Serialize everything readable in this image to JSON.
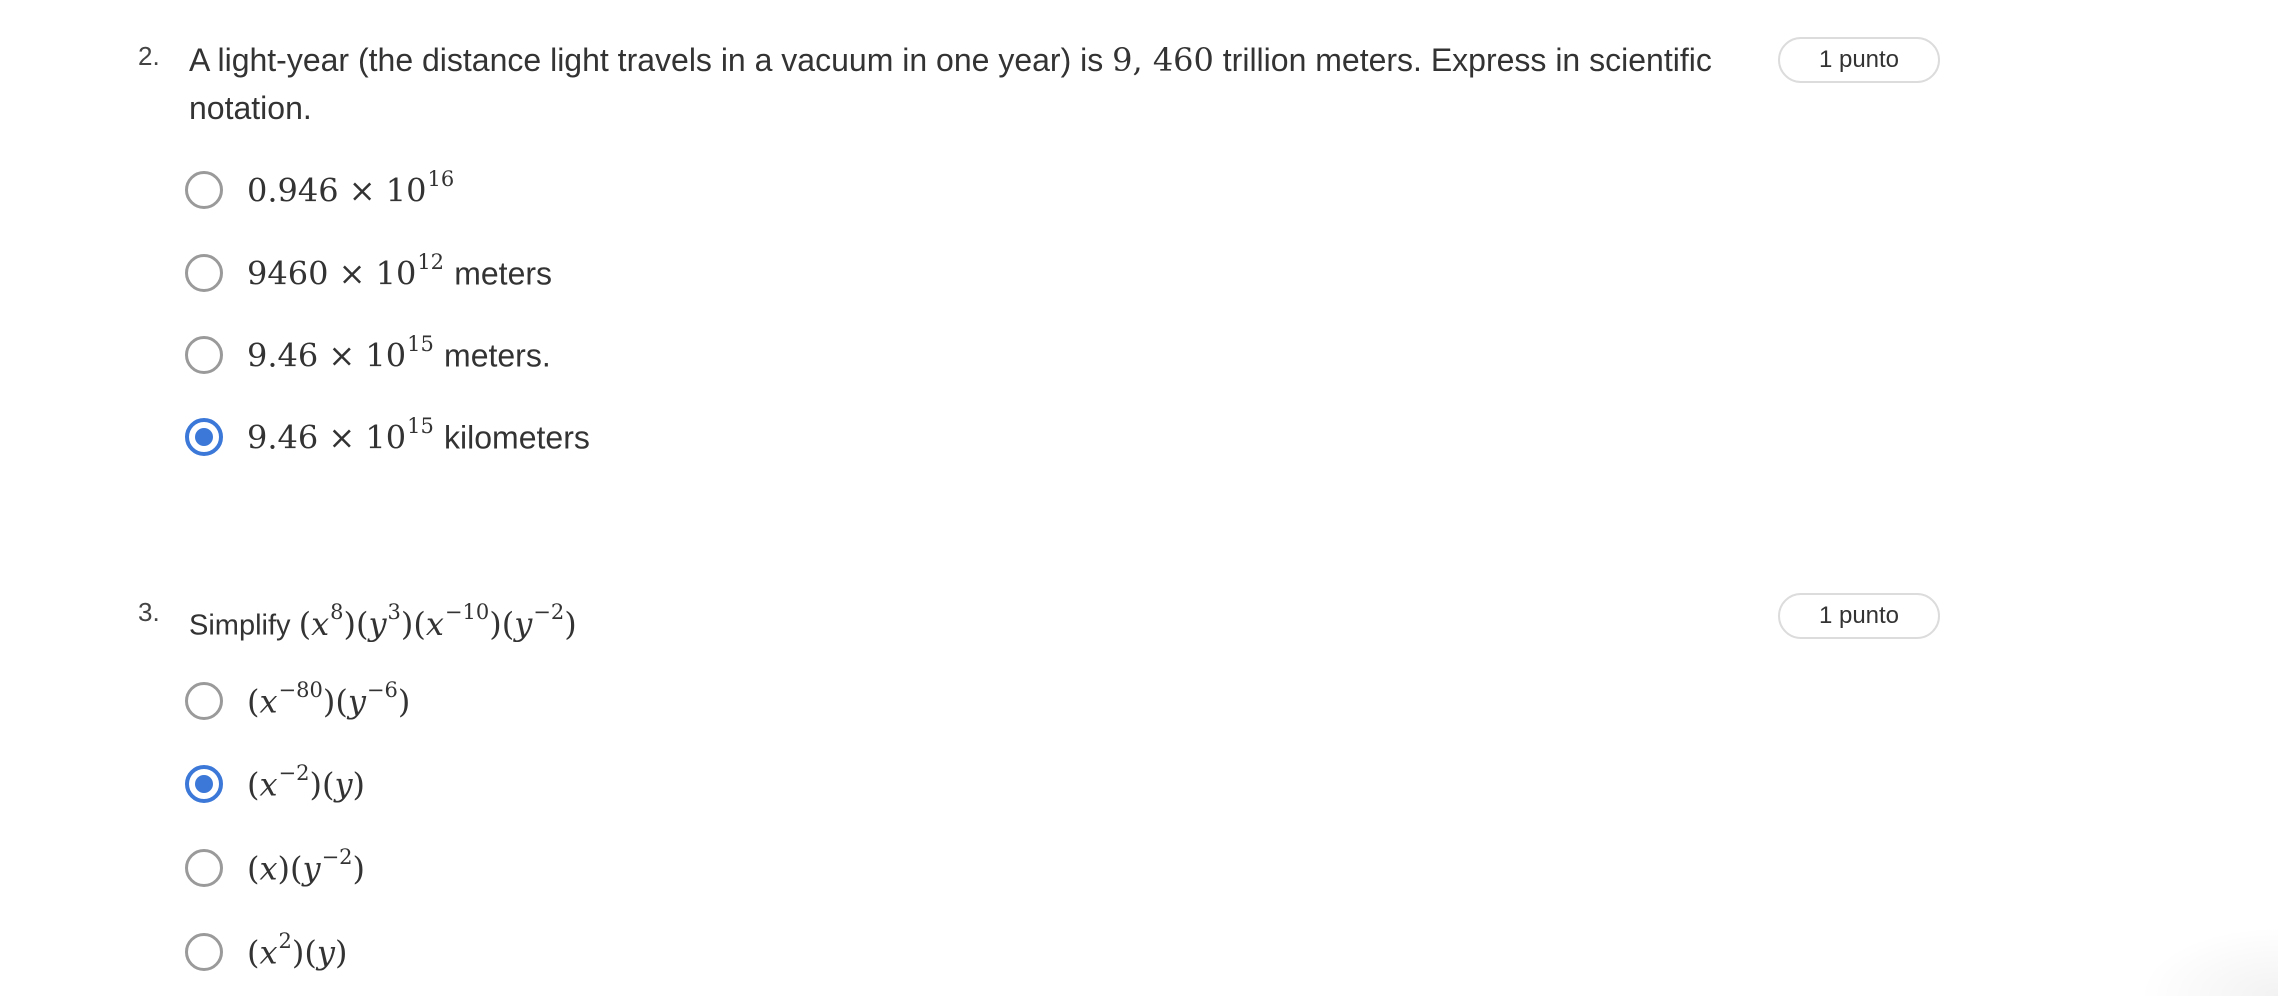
{
  "questions": [
    {
      "number": "2.",
      "text_before": "A light-year (the distance light travels in a vacuum in one year) is",
      "text_math": "9, 460",
      "text_after": "trillion meters. Express in scientific notation.",
      "points": "1 punto",
      "options": [
        {
          "coef": "0.946",
          "times": "×",
          "base": "10",
          "exp": "16",
          "unit": "",
          "selected": false
        },
        {
          "coef": "9460",
          "times": "×",
          "base": "10",
          "exp": "12",
          "unit": "meters",
          "selected": false
        },
        {
          "coef": "9.46",
          "times": "×",
          "base": "10",
          "exp": "15",
          "unit": "meters.",
          "selected": false
        },
        {
          "coef": "9.46",
          "times": "×",
          "base": "10",
          "exp": "15",
          "unit": "kilometers",
          "selected": true
        }
      ]
    },
    {
      "number": "3.",
      "prompt": "Simplify",
      "points": "1 punto",
      "expression": {
        "p1_var": "x",
        "p1_exp": "8",
        "p2_var": "y",
        "p2_exp": "3",
        "p3_var": "x",
        "p3_exp": "−10",
        "p4_var": "y",
        "p4_exp": "−2"
      },
      "options": [
        {
          "a_var": "x",
          "a_exp": "−80",
          "b_var": "y",
          "b_exp": "−6",
          "selected": false
        },
        {
          "a_var": "x",
          "a_exp": "−2",
          "b_var": "y",
          "b_exp": "",
          "selected": true
        },
        {
          "a_var": "x",
          "a_exp": "",
          "b_var": "y",
          "b_exp": "−2",
          "selected": false
        },
        {
          "a_var": "x",
          "a_exp": "2",
          "b_var": "y",
          "b_exp": "",
          "selected": false
        }
      ]
    }
  ],
  "colors": {
    "accent": "#3b78d8",
    "radio_border": "#9a9a9a",
    "badge_border": "#dcdcdc",
    "text": "#333333"
  }
}
